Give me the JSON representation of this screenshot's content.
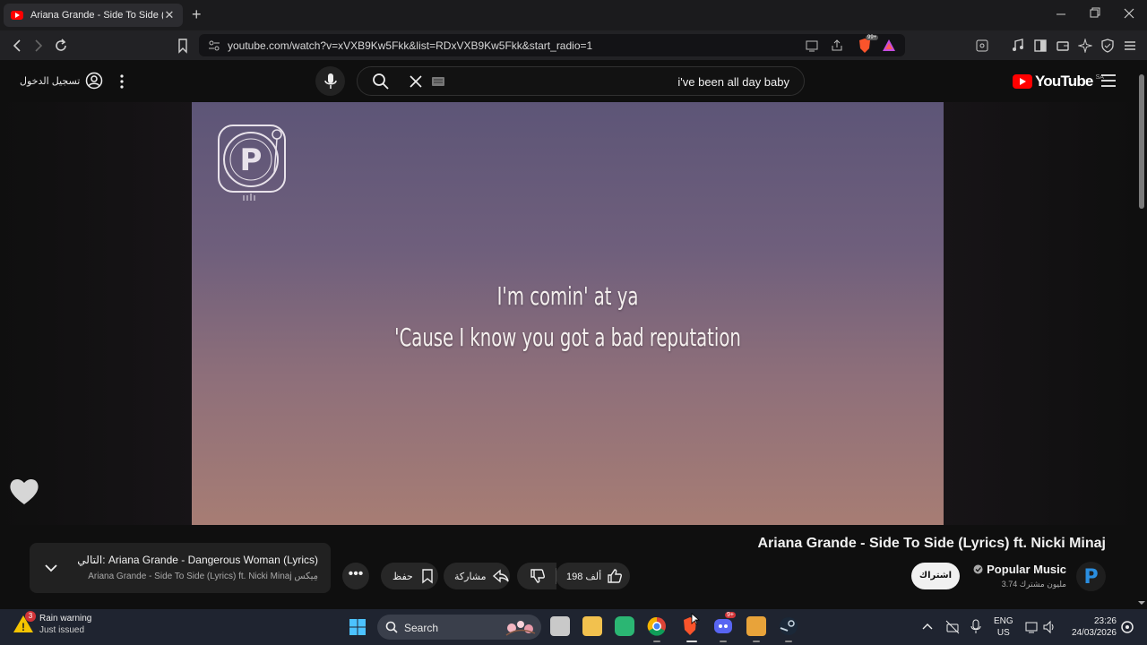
{
  "browser": {
    "tab_title": "Ariana Grande - Side To Side (Lyrics",
    "tab_close": "✕",
    "new_tab": "+",
    "url": "youtube.com/watch?v=xVXB9Kw5Fkk&list=RDxVXB9Kw5Fkk&start_radio=1",
    "shield_badge": "99+"
  },
  "youtube": {
    "sign_in_label": "تسجيل الدخول",
    "search_query": "i've been all day baby",
    "logo_text": "YouTube",
    "logo_country": "SA"
  },
  "video": {
    "lyrics_line1": "I'm comin' at ya",
    "lyrics_line2": "'Cause I know you got a bad reputation"
  },
  "info": {
    "title": "Ariana Grande - Side To Side (Lyrics) ft. Nicki Minaj",
    "channel_name": "Popular Music",
    "subscribers": "3.74 مليون مشترك",
    "subscribe_label": "اشتراك",
    "like_count": "198 ألف",
    "share_label": "مشاركة",
    "save_label": "حفظ",
    "more_label": "•••"
  },
  "next_up": {
    "label": "التالي: Ariana Grande - Dangerous Woman (Lyrics)",
    "sub": "Ariana Grande - Side To Side (Lyrics) ft. Nicki Minaj مِيكس"
  },
  "taskbar": {
    "weather_title": "Rain warning",
    "weather_sub": "Just issued",
    "weather_badge": "3",
    "search_label": "Search",
    "lang1": "ENG",
    "lang2": "US",
    "time": "23:26",
    "date": "24/03/2026",
    "discord_badge": "9+"
  },
  "colors": {
    "youtube_red": "#ff0000",
    "page_bg": "#0f0f0f",
    "video_top": "#5d5577",
    "video_bottom": "#a77d74"
  }
}
